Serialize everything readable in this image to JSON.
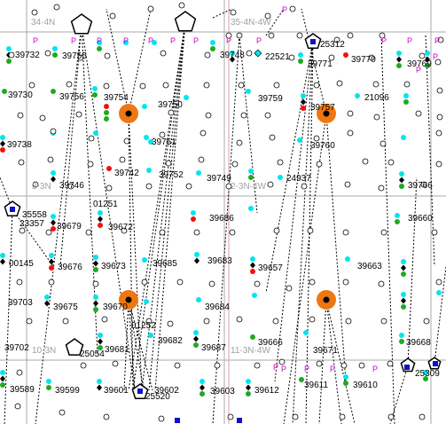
{
  "map": {
    "colors": {
      "grid_line": "#a8a8a8",
      "section_line_red": "#d4a0a0",
      "well_cyan": "#00e5ee",
      "well_green": "#1faa1f",
      "well_red": "#ee1111",
      "well_black": "#000000",
      "well_open": "#ffffff",
      "permit_magenta": "#cc00cc",
      "orange_marker": "#ee7711",
      "blue_marker": "#1010cc"
    },
    "township_labels": [
      "34-4N",
      "35-4N-4W",
      "3-3N",
      "2-3N-4W",
      "10-3N",
      "11-3N-4W"
    ],
    "permit_markers": [
      "P",
      "P",
      "P",
      "P",
      "P",
      "P",
      "P",
      "P",
      "P",
      "P",
      "P",
      "P",
      "P",
      "P",
      "P",
      "P",
      "P",
      "P",
      "P",
      "P"
    ],
    "well_labels": [
      "39732",
      "39755",
      "39748",
      "22521",
      "25312",
      "39771",
      "39770",
      "39769",
      "39730",
      "39756",
      "39754",
      "39750",
      "39759",
      "39757",
      "21096",
      "39738",
      "39751",
      "39760",
      "39742",
      "39752",
      "39749",
      "24937",
      "39766",
      "39746",
      "01251",
      "35558",
      "23357",
      "39679",
      "39672",
      "39686",
      "39660",
      "00145",
      "39676",
      "39673",
      "39685",
      "39683",
      "39657",
      "39663",
      "39703",
      "39675",
      "39670",
      "39684",
      "01252",
      "39682",
      "39687",
      "39666",
      "39671",
      "39668",
      "39702",
      "25054",
      "39681",
      "39589",
      "39599",
      "39601",
      "39602",
      "25520",
      "39603",
      "39612",
      "39611",
      "39610",
      "25309"
    ]
  }
}
